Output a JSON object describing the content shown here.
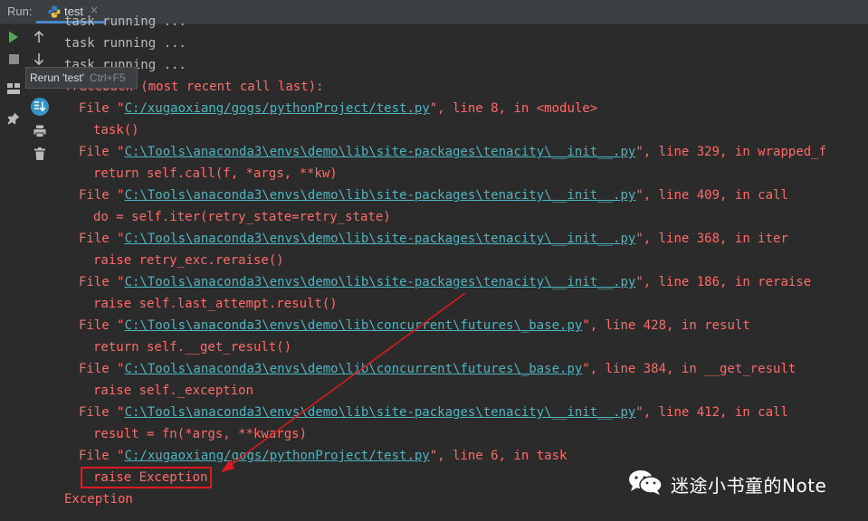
{
  "run_panel": {
    "label": "Run:",
    "tab": {
      "label": "test",
      "close_glyph": "×",
      "icon": "python-icon"
    },
    "accent_color": "#4a88c7"
  },
  "toolbar": [
    {
      "name": "rerun-icon",
      "color": "#5aa35a"
    },
    {
      "name": "stop-icon",
      "color": "#8c8c8c"
    },
    {
      "name": "layout-icon",
      "color": "#bbbbbb"
    },
    {
      "name": "pin-icon",
      "color": "#bbbbbb"
    },
    {
      "name": "up-arrow-icon",
      "color": "#bbbbbb"
    },
    {
      "name": "down-arrow-icon",
      "color": "#bbbbbb"
    },
    {
      "name": "scroll-to-end-icon",
      "color": "#3592c4"
    },
    {
      "name": "print-icon",
      "color": "#bbbbbb"
    },
    {
      "name": "trash-icon",
      "color": "#bbbbbb"
    }
  ],
  "tooltip": {
    "label": "Rerun 'test'",
    "shortcut": "Ctrl+F5"
  },
  "console": {
    "plain_lines": [
      "task running ...",
      "task running ...",
      "task running ..."
    ],
    "traceback_header": "Traceback (most recent call last):",
    "frames": [
      {
        "prefix": "File \"",
        "path": "C:/xugaoxiang/gogs/pythonProject/test.py",
        "suffix": "\", line 8, in <module>",
        "code": "task()"
      },
      {
        "prefix": "File \"",
        "path": "C:\\Tools\\anaconda3\\envs\\demo\\lib\\site-packages\\tenacity\\__init__.py",
        "suffix": "\", line 329, in wrapped_f",
        "code": "return self.call(f, *args, **kw)"
      },
      {
        "prefix": "File \"",
        "path": "C:\\Tools\\anaconda3\\envs\\demo\\lib\\site-packages\\tenacity\\__init__.py",
        "suffix": "\", line 409, in call",
        "code": "do = self.iter(retry_state=retry_state)"
      },
      {
        "prefix": "File \"",
        "path": "C:\\Tools\\anaconda3\\envs\\demo\\lib\\site-packages\\tenacity\\__init__.py",
        "suffix": "\", line 368, in iter",
        "code": "raise retry_exc.reraise()"
      },
      {
        "prefix": "File \"",
        "path": "C:\\Tools\\anaconda3\\envs\\demo\\lib\\site-packages\\tenacity\\__init__.py",
        "suffix": "\", line 186, in reraise",
        "code": "raise self.last_attempt.result()"
      },
      {
        "prefix": "File \"",
        "path": "C:\\Tools\\anaconda3\\envs\\demo\\lib\\concurrent\\futures\\_base.py",
        "suffix": "\", line 428, in result",
        "code": "return self.__get_result()"
      },
      {
        "prefix": "File \"",
        "path": "C:\\Tools\\anaconda3\\envs\\demo\\lib\\concurrent\\futures\\_base.py",
        "suffix": "\", line 384, in __get_result",
        "code": "raise self._exception"
      },
      {
        "prefix": "File \"",
        "path": "C:\\Tools\\anaconda3\\envs\\demo\\lib\\site-packages\\tenacity\\__init__.py",
        "suffix": "\", line 412, in call",
        "code": "result = fn(*args, **kwargs)"
      },
      {
        "prefix": "File \"",
        "path": "C:/xugaoxiang/gogs/pythonProject/test.py",
        "suffix": "\", line 6, in task",
        "code": "raise Exception"
      }
    ],
    "final_line": "Exception",
    "error_color": "#ff6b68",
    "link_color": "#4db5c2",
    "text_color": "#bbbbbb"
  },
  "annotation": {
    "color": "#e0191e"
  },
  "watermark": {
    "text": "迷途小书童的Note",
    "icon": "wechat-icon"
  }
}
